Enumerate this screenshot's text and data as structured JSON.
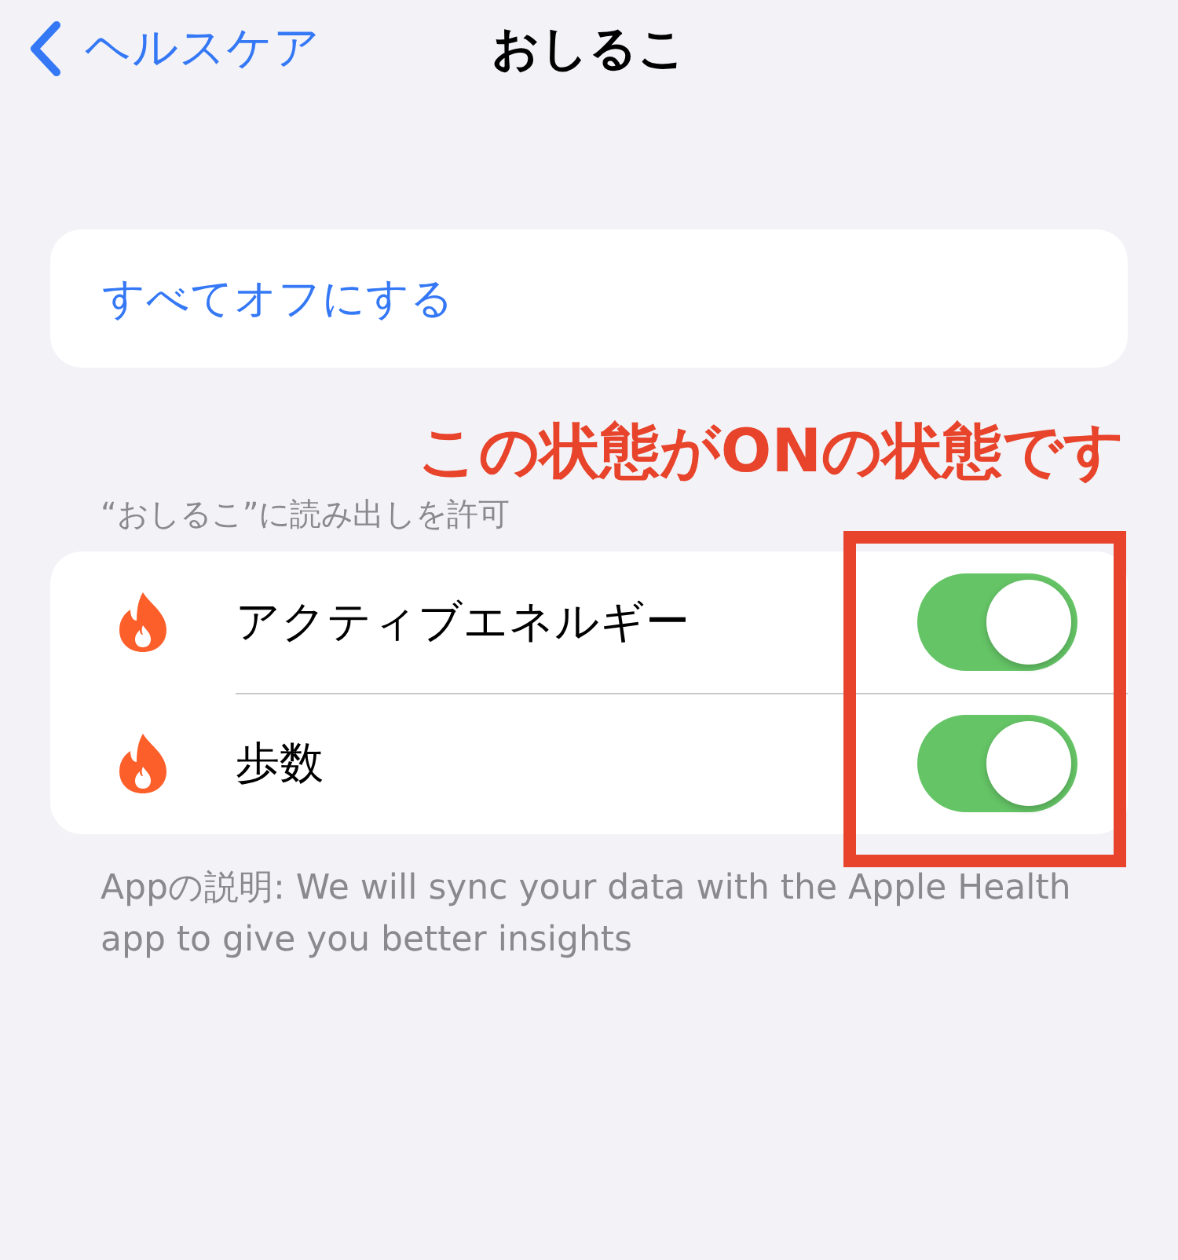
{
  "nav": {
    "back": "ヘルスケア",
    "title": "おしるこ"
  },
  "turn_off_all": "すべてオフにする",
  "annotation": "この状態がONの状態です",
  "section_header": "“おしるこ”に読み出しを許可",
  "permissions": [
    {
      "label": "アクティブエネルギー",
      "on": true
    },
    {
      "label": "歩数",
      "on": true
    }
  ],
  "footer": "Appの説明: We will sync your data with the Apple Health app to give you better insights"
}
